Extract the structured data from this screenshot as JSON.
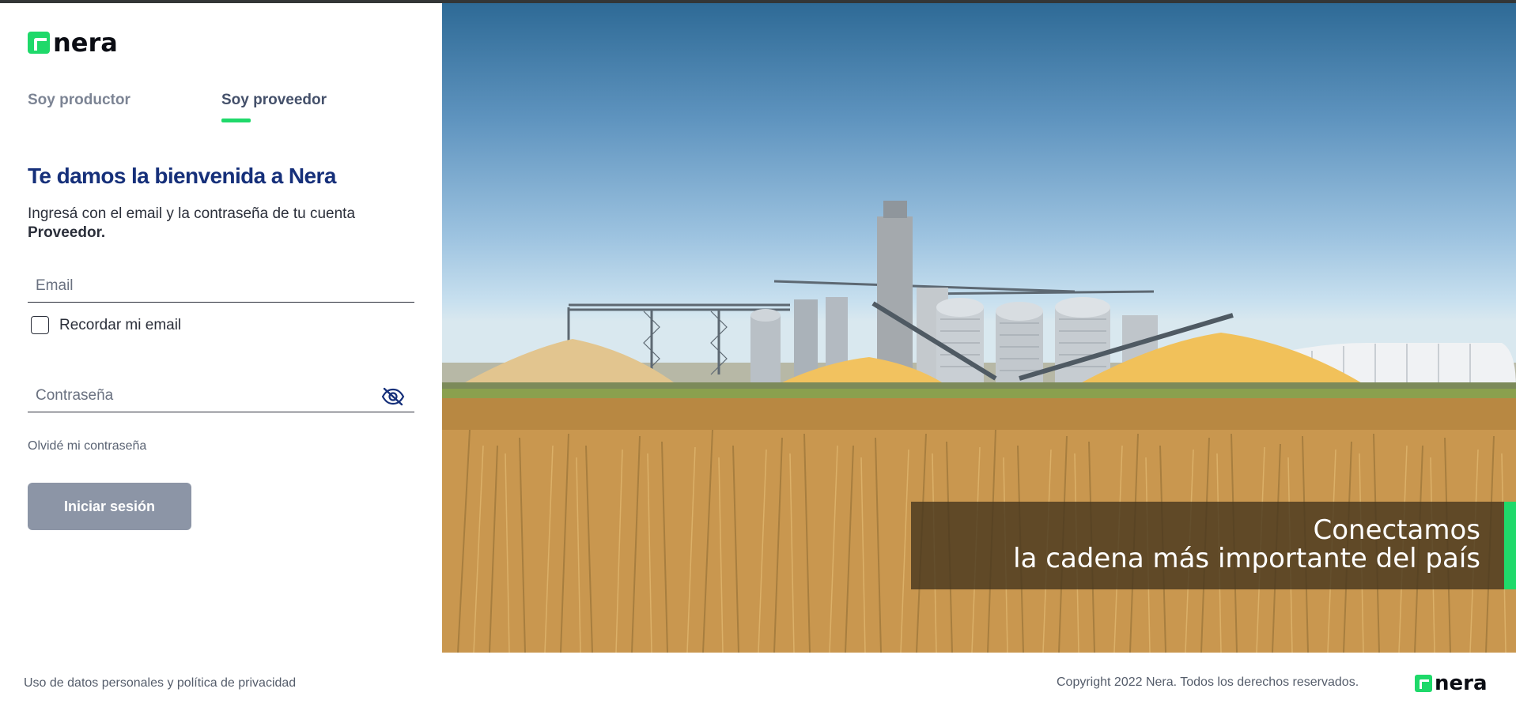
{
  "brand": {
    "name": "nera",
    "color": "#1fd96a"
  },
  "tabs": [
    {
      "label": "Soy productor",
      "active": false
    },
    {
      "label": "Soy proveedor",
      "active": true
    }
  ],
  "login": {
    "title": "Te damos la bienvenida a Nera",
    "subtitle": "Ingresá con el email y la contraseña de tu cuenta",
    "account_type": "Proveedor.",
    "email_placeholder": "Email",
    "remember_label": "Recordar mi email",
    "password_placeholder": "Contraseña",
    "forgot_label": "Olvidé mi contraseña",
    "submit_label": "Iniciar sesión"
  },
  "hero": {
    "line1": "Conectamos",
    "line2": "la cadena más importante del país"
  },
  "footer": {
    "privacy_link": "Uso de datos personales y política de privacidad",
    "copyright": "Copyright 2022 Nera. Todos los derechos reservados."
  },
  "icons": {
    "password_toggle": "eye-slash-icon"
  }
}
